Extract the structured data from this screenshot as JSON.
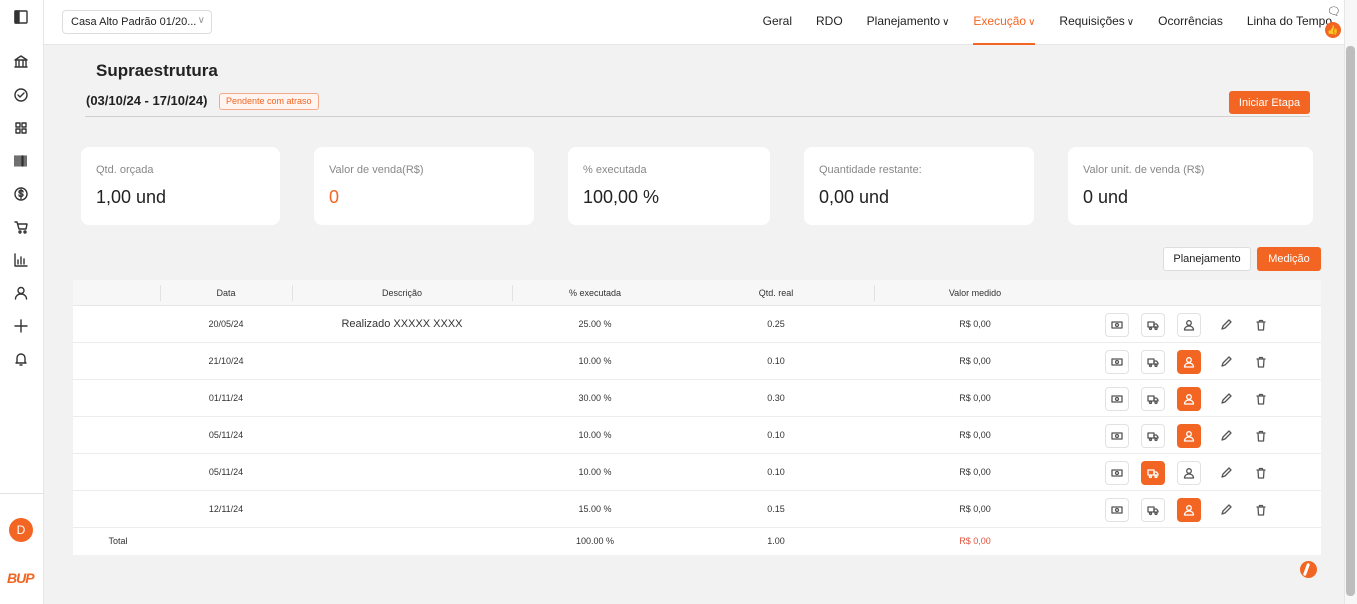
{
  "app": {
    "project_select": "Casa Alto Padrão 01/20...",
    "nav": [
      {
        "label": "Geral",
        "dropdown": false,
        "active": false
      },
      {
        "label": "RDO",
        "dropdown": false,
        "active": false
      },
      {
        "label": "Planejamento",
        "dropdown": true,
        "active": false
      },
      {
        "label": "Execução",
        "dropdown": true,
        "active": true
      },
      {
        "label": "Requisições",
        "dropdown": true,
        "active": false
      },
      {
        "label": "Ocorrências",
        "dropdown": false,
        "active": false
      },
      {
        "label": "Linha do Tempo",
        "dropdown": false,
        "active": false
      }
    ],
    "sidebar_icons": [
      "panel-toggle-icon",
      "bank-icon",
      "check-circle-icon",
      "grid-icon",
      "barcode-icon",
      "dollar-icon",
      "cart-icon",
      "bar-chart-icon",
      "user-icon",
      "plus-icon",
      "bell-icon"
    ],
    "avatar_initial": "D",
    "logo_text": "BUP",
    "accent_color": "#f26522"
  },
  "stage": {
    "title": "Supraestrutura",
    "dates": "(03/10/24 - 17/10/24)",
    "status_badge": "Pendente com atraso",
    "start_button": "Iniciar Etapa"
  },
  "cards": [
    {
      "label": "Qtd. orçada",
      "value": "1,00 und"
    },
    {
      "label": "Valor de venda(R$)",
      "value": "0"
    },
    {
      "label": "% executada",
      "value": "100,00 %"
    },
    {
      "label": "Quantidade restante:",
      "value": "0,00 und"
    },
    {
      "label": "Valor unit. de venda (R$)",
      "value": "0 und"
    }
  ],
  "tabs": {
    "planejamento": "Planejamento",
    "medicao": "Medição"
  },
  "table": {
    "headers": {
      "data": "Data",
      "descricao": "Descrição",
      "percent": "% executada",
      "qtd": "Qtd. real",
      "valor": "Valor medido"
    },
    "rows": [
      {
        "data": "20/05/24",
        "descricao": "Realizado XXXXX XXXX",
        "percent": "25.00 %",
        "qtd": "0.25",
        "valor": "R$ 0,00",
        "truck_active": false,
        "person_active": false
      },
      {
        "data": "21/10/24",
        "descricao": "",
        "percent": "10.00 %",
        "qtd": "0.10",
        "valor": "R$ 0,00",
        "truck_active": false,
        "person_active": true
      },
      {
        "data": "01/11/24",
        "descricao": "",
        "percent": "30.00 %",
        "qtd": "0.30",
        "valor": "R$ 0,00",
        "truck_active": false,
        "person_active": true
      },
      {
        "data": "05/11/24",
        "descricao": "",
        "percent": "10.00 %",
        "qtd": "0.10",
        "valor": "R$ 0,00",
        "truck_active": false,
        "person_active": true
      },
      {
        "data": "05/11/24",
        "descricao": "",
        "percent": "10.00 %",
        "qtd": "0.10",
        "valor": "R$ 0,00",
        "truck_active": true,
        "person_active": false
      },
      {
        "data": "12/11/24",
        "descricao": "",
        "percent": "15.00 %",
        "qtd": "0.15",
        "valor": "R$ 0,00",
        "truck_active": false,
        "person_active": true
      }
    ],
    "total": {
      "label": "Total",
      "percent": "100.00 %",
      "qtd": "1.00",
      "valor": "R$ 0,00"
    }
  }
}
